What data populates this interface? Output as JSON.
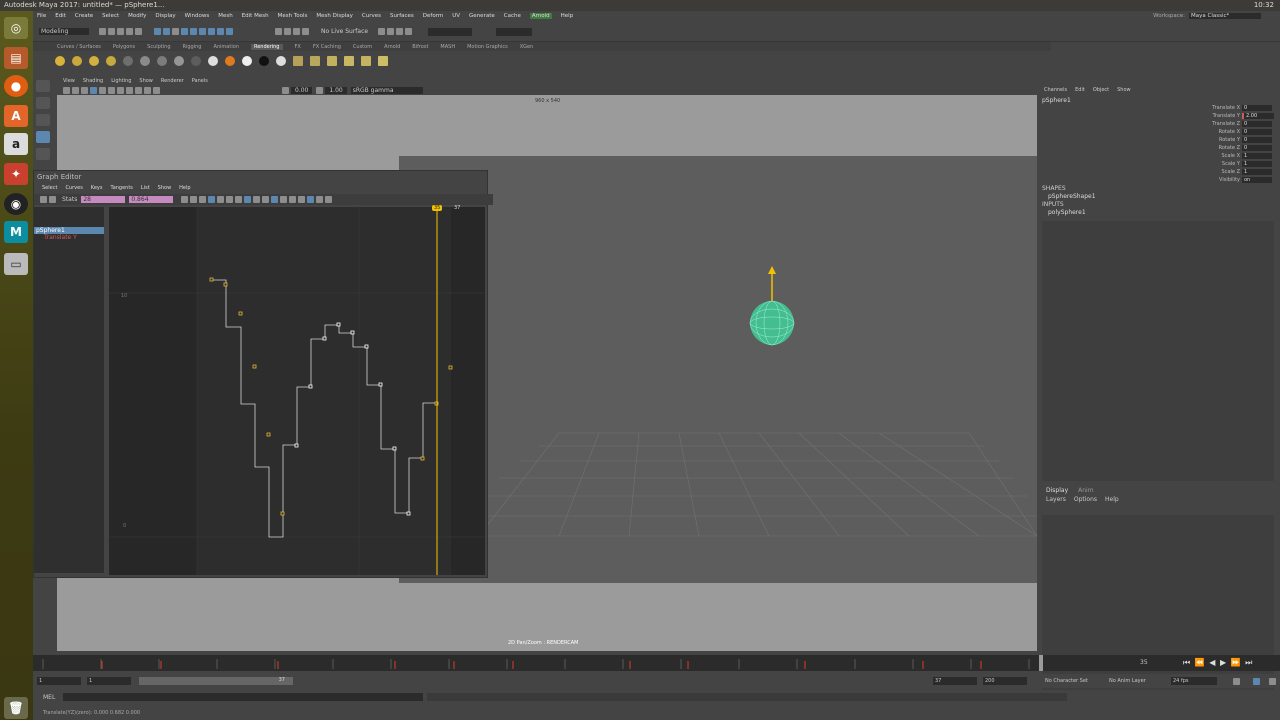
{
  "os": {
    "window_title": "Autodesk Maya 2017: untitled*  —  pSphere1...",
    "clock": "10:32",
    "launcher_items": [
      "ubuntu-logo-icon",
      "files-icon",
      "firefox-icon",
      "software-center-icon",
      "amazon-icon",
      "settings-icon",
      "obs-icon",
      "maya-icon",
      "drive-icon",
      "trash-icon"
    ]
  },
  "maya": {
    "menus": [
      "File",
      "Edit",
      "Create",
      "Select",
      "Modify",
      "Display",
      "Windows",
      "Mesh",
      "Edit Mesh",
      "Mesh Tools",
      "Mesh Display",
      "Curves",
      "Surfaces",
      "Deform",
      "UV",
      "Generate",
      "Cache",
      "Arnold",
      "Help"
    ],
    "workspace_label": "Workspace:",
    "workspace_value": "Maya Classic*",
    "mode": "Modeling",
    "live_surface": "No Live Surface",
    "shelf_tabs": [
      "Curves / Surfaces",
      "Polygons",
      "Sculpting",
      "Rigging",
      "Animation",
      "Rendering",
      "FX",
      "FX Caching",
      "Custom",
      "Arnold",
      "Bifrost",
      "MASH",
      "Motion Graphics",
      "XGen"
    ],
    "active_shelf": "Rendering",
    "panel_menus": [
      "View",
      "Shading",
      "Lighting",
      "Show",
      "Renderer",
      "Panels"
    ],
    "viewport_values": {
      "a": "0.00",
      "b": "1.00",
      "color": "sRGB gamma"
    },
    "resolution": "960 x 540",
    "camera_label": "2D Pan/Zoom : RENDERCAM"
  },
  "graph_editor": {
    "title": "Graph Editor",
    "menus": [
      "Select",
      "Curves",
      "Keys",
      "Tangents",
      "List",
      "Show",
      "Help"
    ],
    "stats_label": "Stats",
    "stats_a": "28",
    "stats_b": "0.864",
    "outliner_items": [
      "pSphere1",
      "Translate Y"
    ],
    "current_frame": "35",
    "end_frame": "37",
    "y_labels": [
      "10",
      "0"
    ]
  },
  "channel_box": {
    "menus": [
      "Channels",
      "Edit",
      "Object",
      "Show"
    ],
    "object": "pSphere1",
    "attributes": [
      {
        "name": "Translate X",
        "value": "0"
      },
      {
        "name": "Translate Y",
        "value": "2.00"
      },
      {
        "name": "Translate Z",
        "value": "0"
      },
      {
        "name": "Rotate X",
        "value": "0"
      },
      {
        "name": "Rotate Y",
        "value": "0"
      },
      {
        "name": "Rotate Z",
        "value": "0"
      },
      {
        "name": "Scale X",
        "value": "1"
      },
      {
        "name": "Scale Y",
        "value": "1"
      },
      {
        "name": "Scale Z",
        "value": "1"
      },
      {
        "name": "Visibility",
        "value": "on"
      }
    ],
    "shapes_label": "SHAPES",
    "shape": "pSphereShape1",
    "inputs_label": "INPUTS",
    "input": "polySphere1",
    "layer_tabs": [
      "Display",
      "Anim"
    ],
    "layer_menus": [
      "Layers",
      "Options",
      "Help"
    ]
  },
  "timeline": {
    "range_start": "1",
    "playback_start": "1",
    "slider_end": "37",
    "playback_end": "37",
    "range_end": "200",
    "current_frame": "35",
    "character_set": "No Character Set",
    "anim_layer": "No Anim Layer",
    "fps": "24 fps",
    "mel_label": "MEL",
    "help_line": "Translate(YZ)(zero):  0.000   0.682   0.000"
  },
  "colors": {
    "accent": "#f2c200",
    "selection": "#5c88b0",
    "sphere": "#3fcf9a"
  }
}
